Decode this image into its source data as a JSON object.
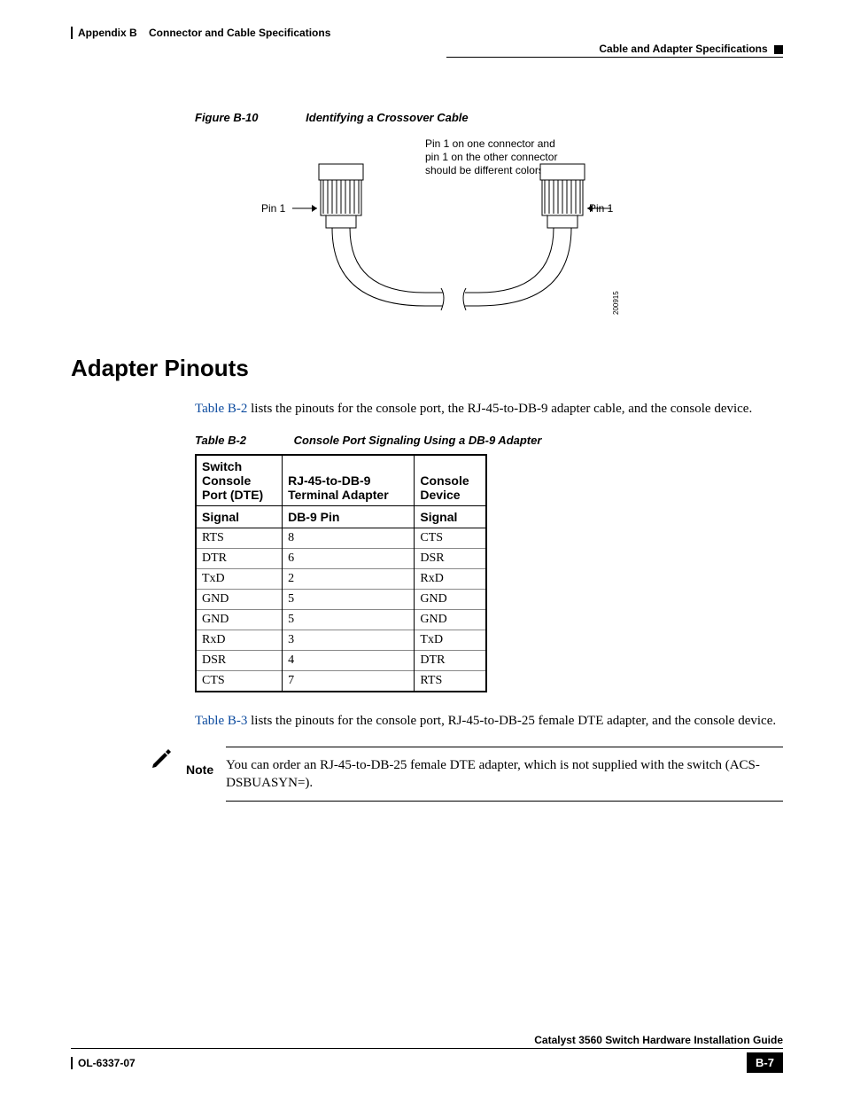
{
  "header": {
    "left_prefix": "Appendix B",
    "left_title": "Connector and Cable Specifications",
    "right_title": "Cable and Adapter Specifications"
  },
  "figure": {
    "label": "Figure B-10",
    "title": "Identifying a Crossover Cable",
    "note_line1": "Pin 1 on one connector and",
    "note_line2": "pin 1 on the other connector",
    "note_line3": "should be different colors.",
    "pin_left": "Pin 1",
    "pin_right": "Pin 1",
    "artnum": "200915"
  },
  "section_heading": "Adapter Pinouts",
  "intro_para": {
    "link": "Table B-2",
    "rest": " lists the pinouts for the console port, the RJ-45-to-DB-9 adapter cable, and the console device."
  },
  "table": {
    "label": "Table B-2",
    "title": "Console Port Signaling Using a DB-9 Adapter",
    "head_row1": {
      "c1a": "Switch",
      "c1b": "Console",
      "c1c": "Port (DTE)",
      "c2a": "RJ-45-to-DB-9",
      "c2b": "Terminal Adapter",
      "c3a": "Console",
      "c3b": "Device"
    },
    "head_row2": {
      "c1": "Signal",
      "c2": "DB-9 Pin",
      "c3": "Signal"
    },
    "rows": [
      {
        "c1": "RTS",
        "c2": "8",
        "c3": "CTS"
      },
      {
        "c1": "DTR",
        "c2": "6",
        "c3": "DSR"
      },
      {
        "c1": "TxD",
        "c2": "2",
        "c3": "RxD"
      },
      {
        "c1": "GND",
        "c2": "5",
        "c3": "GND"
      },
      {
        "c1": "GND",
        "c2": "5",
        "c3": "GND"
      },
      {
        "c1": "RxD",
        "c2": "3",
        "c3": "TxD"
      },
      {
        "c1": "DSR",
        "c2": "4",
        "c3": "DTR"
      },
      {
        "c1": "CTS",
        "c2": "7",
        "c3": "RTS"
      }
    ]
  },
  "chart_data": {
    "type": "table",
    "title": "Console Port Signaling Using a DB-9 Adapter",
    "columns": [
      "Switch Console Port (DTE) Signal",
      "RJ-45-to-DB-9 Terminal Adapter DB-9 Pin",
      "Console Device Signal"
    ],
    "rows": [
      [
        "RTS",
        8,
        "CTS"
      ],
      [
        "DTR",
        6,
        "DSR"
      ],
      [
        "TxD",
        2,
        "RxD"
      ],
      [
        "GND",
        5,
        "GND"
      ],
      [
        "GND",
        5,
        "GND"
      ],
      [
        "RxD",
        3,
        "TxD"
      ],
      [
        "DSR",
        4,
        "DTR"
      ],
      [
        "CTS",
        7,
        "RTS"
      ]
    ]
  },
  "second_para": {
    "link": "Table B-3",
    "rest": " lists the pinouts for the console port, RJ-45-to-DB-25 female DTE adapter, and the console device."
  },
  "note": {
    "label": "Note",
    "text": "You can order an RJ-45-to-DB-25 female DTE adapter, which is not supplied with the switch (ACS-DSBUASYN=)."
  },
  "footer": {
    "guide": "Catalyst 3560 Switch Hardware Installation Guide",
    "docnum": "OL-6337-07",
    "pagenum": "B-7"
  }
}
